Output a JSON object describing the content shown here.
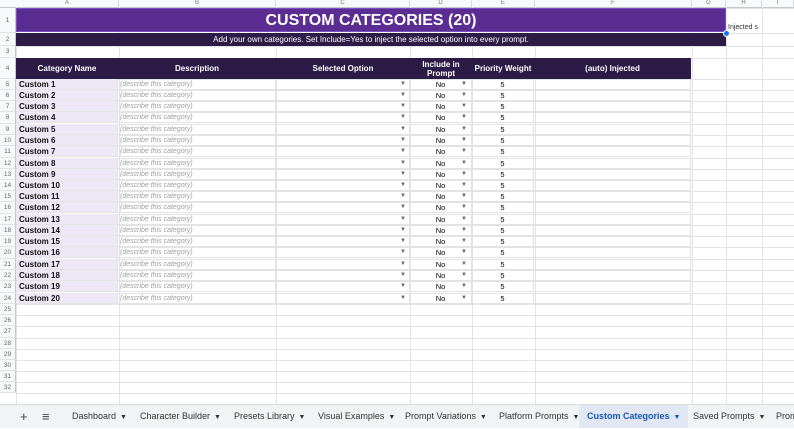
{
  "columns": [
    "A",
    "B",
    "C",
    "D",
    "E",
    "F",
    "G",
    "H",
    "I"
  ],
  "title": "CUSTOM CATEGORIES (20)",
  "subtitle": "Add your own categories. Set Include=Yes to inject the selected option into every prompt.",
  "side_note": "Injected s",
  "headers": {
    "name": "Category Name",
    "description": "Description",
    "selected": "Selected Option",
    "include": "Include in Prompt",
    "weight": "Priority Weight",
    "injected": "(auto) Injected"
  },
  "rows": [
    {
      "name": "Custom 1",
      "desc": "(describe this category)",
      "include": "No",
      "weight": "5"
    },
    {
      "name": "Custom 2",
      "desc": "(describe this category)",
      "include": "No",
      "weight": "5"
    },
    {
      "name": "Custom 3",
      "desc": "(describe this category)",
      "include": "No",
      "weight": "5"
    },
    {
      "name": "Custom 4",
      "desc": "(describe this category)",
      "include": "No",
      "weight": "5"
    },
    {
      "name": "Custom 5",
      "desc": "(describe this category)",
      "include": "No",
      "weight": "5"
    },
    {
      "name": "Custom 6",
      "desc": "(describe this category)",
      "include": "No",
      "weight": "5"
    },
    {
      "name": "Custom 7",
      "desc": "(describe this category)",
      "include": "No",
      "weight": "5"
    },
    {
      "name": "Custom 8",
      "desc": "(describe this category)",
      "include": "No",
      "weight": "5"
    },
    {
      "name": "Custom 9",
      "desc": "(describe this category)",
      "include": "No",
      "weight": "5"
    },
    {
      "name": "Custom 10",
      "desc": "(describe this category)",
      "include": "No",
      "weight": "5"
    },
    {
      "name": "Custom 11",
      "desc": "(describe this category)",
      "include": "No",
      "weight": "5"
    },
    {
      "name": "Custom 12",
      "desc": "(describe this category)",
      "include": "No",
      "weight": "5"
    },
    {
      "name": "Custom 13",
      "desc": "(describe this category)",
      "include": "No",
      "weight": "5"
    },
    {
      "name": "Custom 14",
      "desc": "(describe this category)",
      "include": "No",
      "weight": "5"
    },
    {
      "name": "Custom 15",
      "desc": "(describe this category)",
      "include": "No",
      "weight": "5"
    },
    {
      "name": "Custom 16",
      "desc": "(describe this category)",
      "include": "No",
      "weight": "5"
    },
    {
      "name": "Custom 17",
      "desc": "(describe this category)",
      "include": "No",
      "weight": "5"
    },
    {
      "name": "Custom 18",
      "desc": "(describe this category)",
      "include": "No",
      "weight": "5"
    },
    {
      "name": "Custom 19",
      "desc": "(describe this category)",
      "include": "No",
      "weight": "5"
    },
    {
      "name": "Custom 20",
      "desc": "(describe this category)",
      "include": "No",
      "weight": "5"
    }
  ],
  "row_numbers": [
    "1",
    "2",
    "3",
    "4",
    "5",
    "6",
    "7",
    "8",
    "9",
    "10",
    "11",
    "12",
    "13",
    "14",
    "15",
    "16",
    "17",
    "18",
    "19",
    "20",
    "21",
    "22",
    "23",
    "24",
    "25",
    "26",
    "27",
    "28",
    "29",
    "30",
    "31",
    "32"
  ],
  "tabs": [
    {
      "label": "Dashboard",
      "active": false
    },
    {
      "label": "Character Builder",
      "active": false
    },
    {
      "label": "Presets Library",
      "active": false
    },
    {
      "label": "Visual Examples",
      "active": false
    },
    {
      "label": "Prompt Variations",
      "active": false
    },
    {
      "label": "Platform Prompts",
      "active": false
    },
    {
      "label": "Custom Categories",
      "active": true
    },
    {
      "label": "Saved Prompts",
      "active": false
    },
    {
      "label": "Prom",
      "active": false
    }
  ],
  "colors": {
    "title_bg": "#5b2c91",
    "header_bg": "#2d1b47",
    "name_bg": "#ede7f6",
    "active_tab": "#1a57b5"
  }
}
